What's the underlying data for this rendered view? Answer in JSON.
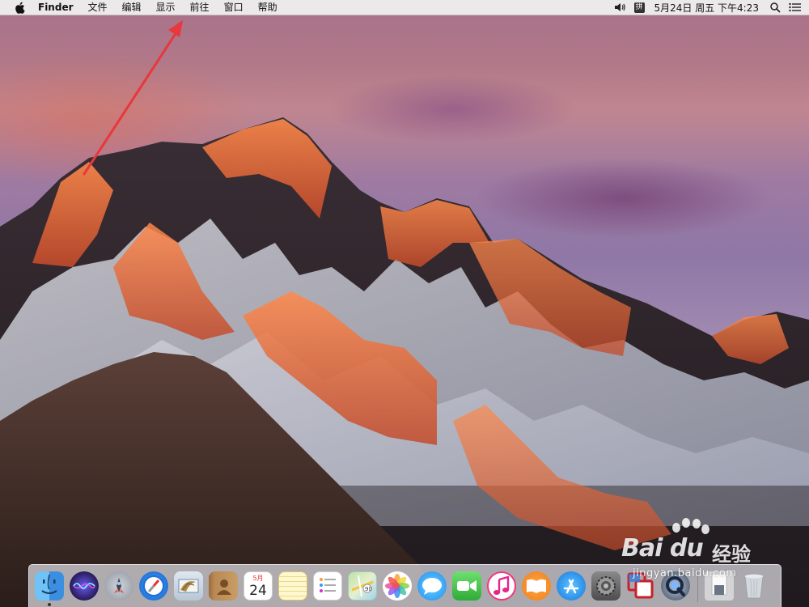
{
  "menubar": {
    "apple_icon": "apple-icon",
    "app_name": "Finder",
    "menus": [
      "文件",
      "编辑",
      "显示",
      "前往",
      "窗口",
      "帮助"
    ],
    "status": {
      "volume_icon": "speaker-icon",
      "input_method": "拼",
      "clock": "5月24日 周五 下午4:23",
      "spotlight_icon": "magnifier-icon",
      "notification_icon": "list-icon"
    }
  },
  "calendar_icon": {
    "month": "5月",
    "day": "24"
  },
  "annotation": {
    "type": "red-arrow",
    "points_to": "前往"
  },
  "watermark": {
    "logo": "Bai du",
    "cn": "经验",
    "url": "jingyan.baidu.com"
  },
  "dock": {
    "apps": [
      "Finder",
      "Siri",
      "Launchpad",
      "Safari",
      "Mail",
      "Contacts",
      "Calendar",
      "Notes",
      "Reminders",
      "Maps",
      "Photos",
      "Messages",
      "FaceTime",
      "iTunes",
      "iBooks",
      "App Store",
      "System Preferences",
      "Parallels",
      "QuickTime"
    ],
    "trailing": [
      "Downloads",
      "Trash"
    ]
  },
  "colors": {
    "arrow": "#e8373d",
    "menubar_bg": "#eeeeee",
    "dock_bg": "#e1e1e6"
  }
}
